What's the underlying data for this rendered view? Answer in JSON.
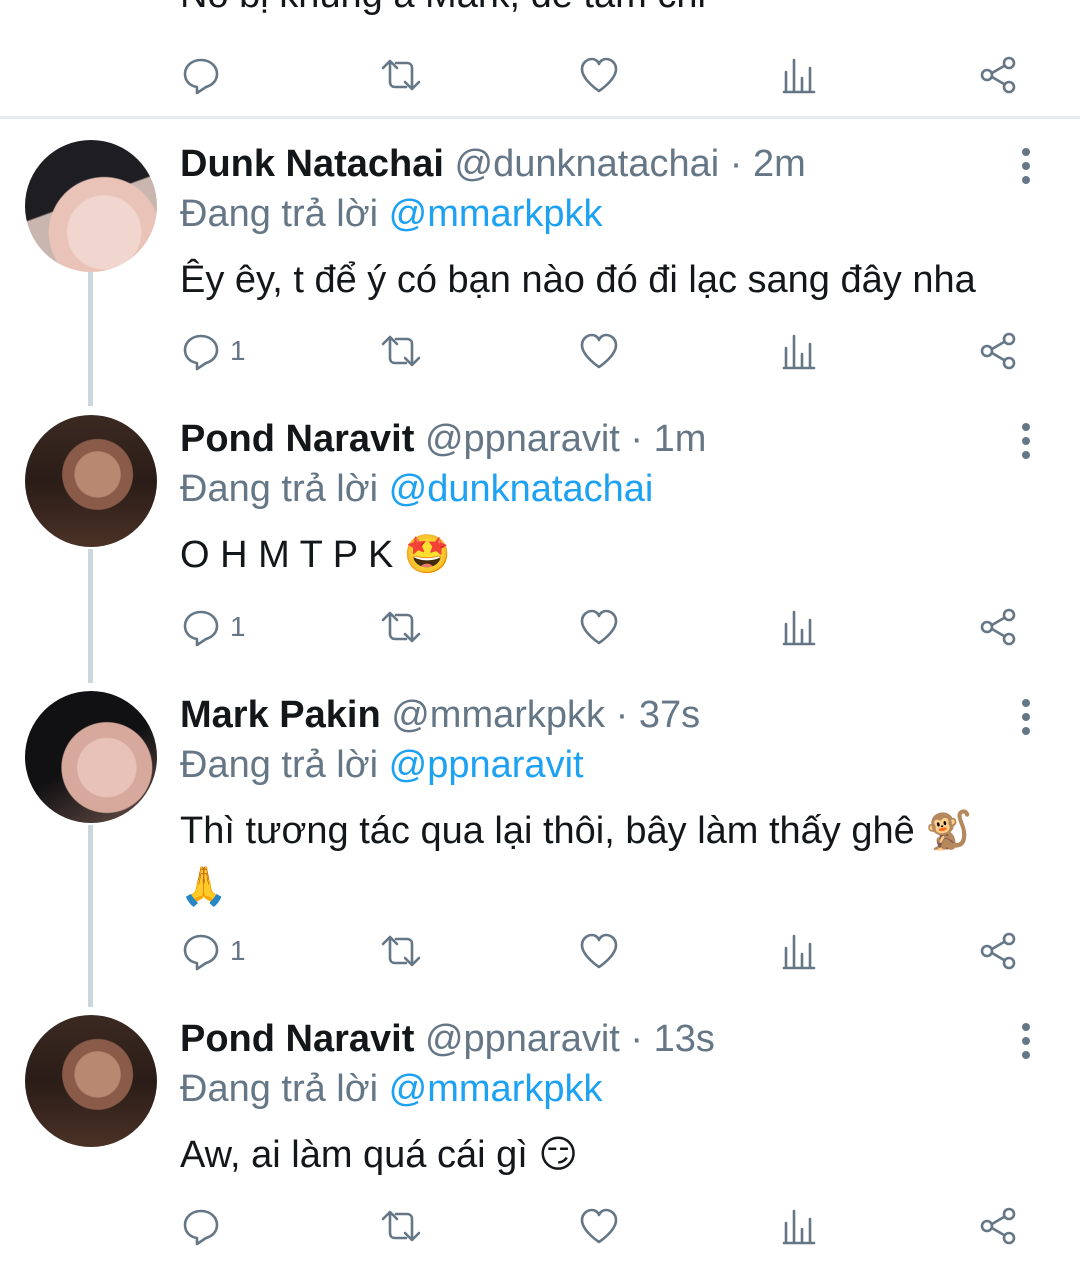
{
  "previous_tweet": {
    "text_partial": "Nó bị khùng á Mark, để tâm chi"
  },
  "reply_prefix": "Đang trả lời",
  "separator": "·",
  "tweets": [
    {
      "display_name": "Dunk Natachai",
      "handle": "@dunknatachai",
      "time": "2m",
      "reply_to": "@mmarkpkk",
      "text": "Êy êy, t để ý có bạn nào đó đi lạc sang đây nha",
      "reply_count": "1"
    },
    {
      "display_name": "Pond Naravit",
      "handle": "@ppnaravit",
      "time": "1m",
      "reply_to": "@dunknatachai",
      "text": "O H M T P K 🤩",
      "reply_count": "1"
    },
    {
      "display_name": "Mark Pakin",
      "handle": "@mmarkpkk",
      "time": "37s",
      "reply_to": "@ppnaravit",
      "text": "Thì tương tác qua lại thôi, bây làm thấy ghê 🐒 🙏",
      "reply_count": "1"
    },
    {
      "display_name": "Pond Naravit",
      "handle": "@ppnaravit",
      "time": "13s",
      "reply_to": "@mmarkpkk",
      "text": "Aw, ai làm quá cái gì 😏",
      "reply_count": ""
    }
  ],
  "colors": {
    "link": "#1da1f2",
    "muted": "#657786",
    "text": "#14171a",
    "thread_line": "#ccd6dd",
    "divider": "#e6ecf0"
  },
  "icons": [
    "reply-icon",
    "retweet-icon",
    "like-icon",
    "stats-icon",
    "share-icon",
    "more-icon"
  ]
}
